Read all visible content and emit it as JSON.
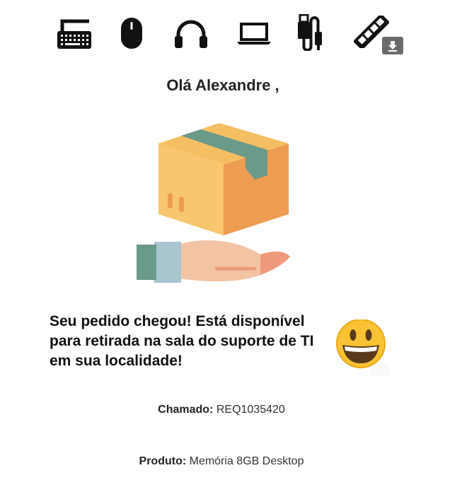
{
  "header_icons": [
    {
      "icon": "keyboard-icon"
    },
    {
      "icon": "mouse-icon"
    },
    {
      "icon": "headphones-icon"
    },
    {
      "icon": "laptop-icon"
    },
    {
      "icon": "usb-cable-icon"
    },
    {
      "icon": "memory-stick-icon"
    }
  ],
  "download_button": {
    "icon": "download-icon"
  },
  "greeting": "Olá Alexandre ,",
  "illustration": {
    "icon": "package-in-hand-icon"
  },
  "message": "Seu pedido chegou! Está disponível para retirada na sala do suporte de TI em sua localidade!",
  "emoji": {
    "icon": "smiling-face-emoji"
  },
  "ticket": {
    "label": "Chamado:",
    "value": "REQ1035420"
  },
  "product": {
    "label": "Produto:",
    "value": "Memória 8GB Desktop"
  },
  "colors": {
    "box_light": "#F7C66E",
    "box_dark": "#EE9C51",
    "tape": "#6A9A8A",
    "hand": "#F3C4A4",
    "sleeve": "#A9C5D0",
    "cuff": "#6A9A8A",
    "emoji_yellow": "#F9C234",
    "download_bg": "#6B6B6B"
  }
}
